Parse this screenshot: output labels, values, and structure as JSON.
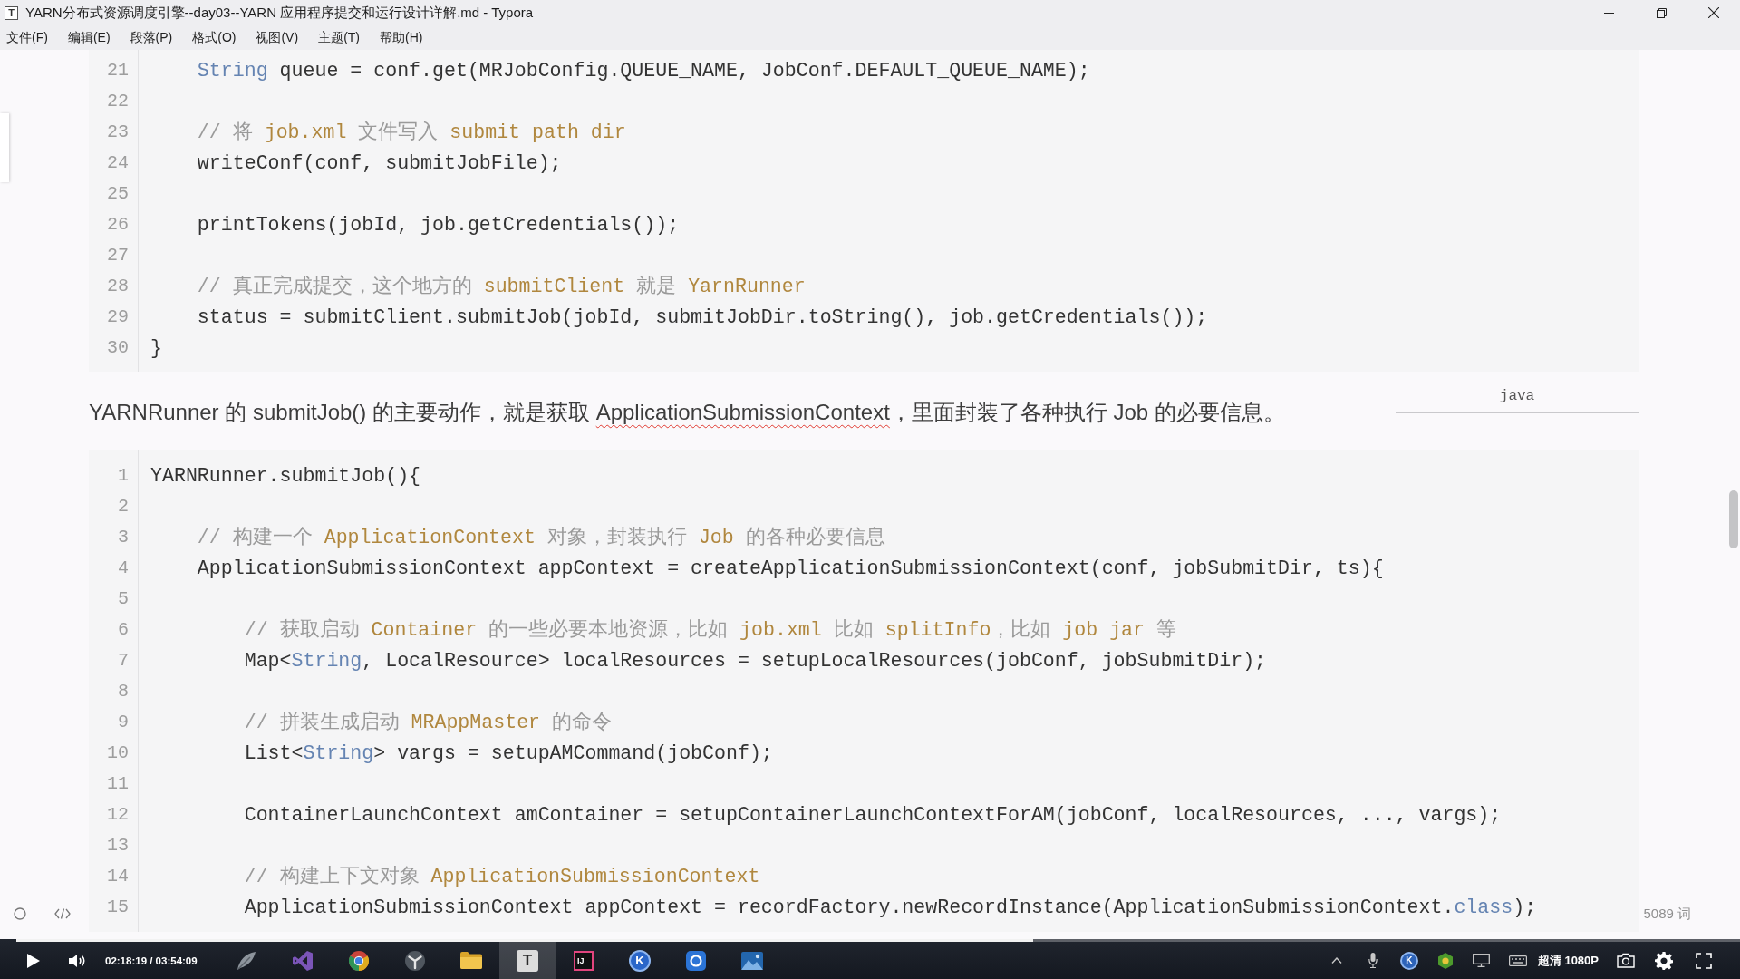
{
  "window": {
    "icon_letter": "T",
    "title": "YARN分布式资源调度引擎--day03--YARN 应用程序提交和运行设计详解.md - Typora"
  },
  "menu": [
    "文件(F)",
    "编辑(E)",
    "段落(P)",
    "格式(O)",
    "视图(V)",
    "主题(T)",
    "帮助(H)"
  ],
  "document": [
    {
      "kind": "code",
      "language": "java",
      "lines": [
        {
          "number": "21",
          "tokens": [
            {
              "kind": "type",
              "text": "    String"
            },
            {
              "kind": "plain",
              "text": " queue = conf.get(MRJobConfig.QUEUE_NAME, JobConf.DEFAULT_QUEUE_NAME);"
            }
          ]
        },
        {
          "number": "22"
        },
        {
          "number": "23",
          "tokens": [
            {
              "kind": "comment",
              "text": "    // 将 "
            },
            {
              "kind": "mark",
              "text": "job.xml"
            },
            {
              "kind": "comment",
              "text": " 文件写入 "
            },
            {
              "kind": "mark",
              "text": "submit path dir"
            }
          ]
        },
        {
          "number": "24",
          "tokens": [
            {
              "kind": "plain",
              "text": "    writeConf(conf, submitJobFile);"
            }
          ]
        },
        {
          "number": "25"
        },
        {
          "number": "26",
          "tokens": [
            {
              "kind": "plain",
              "text": "    printTokens(jobId, job.getCredentials());"
            }
          ]
        },
        {
          "number": "27"
        },
        {
          "number": "28",
          "tokens": [
            {
              "kind": "comment",
              "text": "    // 真正完成提交，这个地方的 "
            },
            {
              "kind": "mark",
              "text": "submitClient"
            },
            {
              "kind": "comment",
              "text": " 就是 "
            },
            {
              "kind": "mark",
              "text": "YarnRunner"
            }
          ]
        },
        {
          "number": "29",
          "tokens": [
            {
              "kind": "plain",
              "text": "    status = submitClient.submitJob(jobId, submitJobDir.toString(), job.getCredentials());"
            }
          ]
        },
        {
          "number": "30",
          "tokens": [
            {
              "kind": "plain",
              "text": "}"
            }
          ]
        }
      ]
    },
    {
      "kind": "paragraph",
      "segments": [
        {
          "text": "YARNRunner 的 submitJob() 的主要动作，就是获取 ",
          "spell_error": false
        },
        {
          "text": "ApplicationSubmissionContext",
          "spell_error": true
        },
        {
          "text": "，里面封装了各种执行 Job 的必要信息。",
          "spell_error": false
        }
      ]
    },
    {
      "kind": "code",
      "lines": [
        {
          "number": "1",
          "tokens": [
            {
              "kind": "plain",
              "text": "YARNRunner.submitJob(){"
            }
          ]
        },
        {
          "number": "2"
        },
        {
          "number": "3",
          "tokens": [
            {
              "kind": "comment",
              "text": "    // 构建一个 "
            },
            {
              "kind": "mark",
              "text": "ApplicationContext"
            },
            {
              "kind": "comment",
              "text": " 对象，封装执行 "
            },
            {
              "kind": "mark",
              "text": "Job"
            },
            {
              "kind": "comment",
              "text": " 的各种必要信息"
            }
          ]
        },
        {
          "number": "4",
          "tokens": [
            {
              "kind": "plain",
              "text": "    ApplicationSubmissionContext appContext = createApplicationSubmissionContext(conf, jobSubmitDir, ts){"
            }
          ]
        },
        {
          "number": "5"
        },
        {
          "number": "6",
          "tokens": [
            {
              "kind": "comment",
              "text": "        // 获取启动 "
            },
            {
              "kind": "mark",
              "text": "Container"
            },
            {
              "kind": "comment",
              "text": " 的一些必要本地资源，比如 "
            },
            {
              "kind": "mark",
              "text": "job.xml"
            },
            {
              "kind": "comment",
              "text": " 比如 "
            },
            {
              "kind": "mark",
              "text": "splitInfo"
            },
            {
              "kind": "comment",
              "text": "，比如 "
            },
            {
              "kind": "mark",
              "text": "job jar"
            },
            {
              "kind": "comment",
              "text": " 等"
            }
          ]
        },
        {
          "number": "7",
          "tokens": [
            {
              "kind": "plain",
              "text": "        Map<"
            },
            {
              "kind": "type",
              "text": "String"
            },
            {
              "kind": "plain",
              "text": ", LocalResource> localResources = setupLocalResources(jobConf, jobSubmitDir);"
            }
          ]
        },
        {
          "number": "8"
        },
        {
          "number": "9",
          "tokens": [
            {
              "kind": "comment",
              "text": "        // 拼装生成启动 "
            },
            {
              "kind": "mark",
              "text": "MRAppMaster"
            },
            {
              "kind": "comment",
              "text": " 的命令"
            }
          ]
        },
        {
          "number": "10",
          "tokens": [
            {
              "kind": "plain",
              "text": "        List<"
            },
            {
              "kind": "type",
              "text": "String"
            },
            {
              "kind": "plain",
              "text": "> vargs = setupAMCommand(jobConf);"
            }
          ]
        },
        {
          "number": "11"
        },
        {
          "number": "12",
          "tokens": [
            {
              "kind": "plain",
              "text": "        ContainerLaunchContext amContainer = setupContainerLaunchContextForAM(jobConf, localResources, ..., vargs);"
            }
          ]
        },
        {
          "number": "13"
        },
        {
          "number": "14",
          "tokens": [
            {
              "kind": "comment",
              "text": "        // 构建上下文对象 "
            },
            {
              "kind": "mark",
              "text": "ApplicationSubmissionContext"
            }
          ]
        },
        {
          "number": "15",
          "tokens": [
            {
              "kind": "plain",
              "text": "        ApplicationSubmissionContext appContext = recordFactory.newRecordInstance(ApplicationSubmissionContext."
            },
            {
              "kind": "type",
              "text": "class"
            },
            {
              "kind": "plain",
              "text": ");"
            }
          ]
        }
      ]
    }
  ],
  "status_bar": {
    "word_count": "5089 词"
  },
  "taskbar": {
    "apps": [
      {
        "kind": "feather",
        "selected": false
      },
      {
        "kind": "ribbon",
        "selected": false
      },
      {
        "kind": "wheel",
        "selected": false
      },
      {
        "kind": "emblem",
        "selected": false
      },
      {
        "kind": "folder",
        "selected": false
      },
      {
        "kind": "tile",
        "letter": "T",
        "selected": true
      },
      {
        "kind": "darktile",
        "letter": "IJ",
        "selected": false
      },
      {
        "kind": "disc",
        "letter": "K",
        "selected": false
      },
      {
        "kind": "square",
        "selected": false
      },
      {
        "kind": "picture",
        "selected": false
      }
    ],
    "tray": [
      {
        "kind": "chevron"
      },
      {
        "kind": "mic"
      },
      {
        "kind": "disc",
        "letter": "K"
      },
      {
        "kind": "hexagon"
      },
      {
        "kind": "monitor"
      },
      {
        "kind": "keyboard"
      }
    ]
  },
  "player": {
    "progress": {
      "level": 0.59
    },
    "time": "02:18:19 / 03:54:09",
    "quality": "超清 1080P"
  }
}
